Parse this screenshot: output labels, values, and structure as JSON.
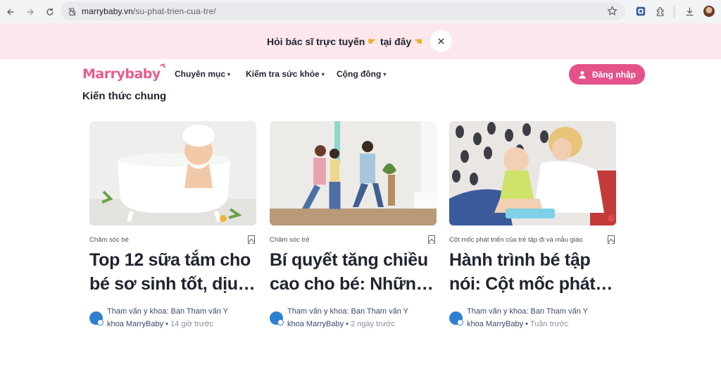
{
  "browser": {
    "url_host": "marrybaby.vn",
    "url_path": "/su-phat-trien-cua-tre/"
  },
  "promo": {
    "text_before": "Hỏi bác sĩ trực tuyến",
    "text_after": "tại đây"
  },
  "header": {
    "logo": "Marrybaby",
    "menu": [
      {
        "label": "Chuyên mục"
      },
      {
        "label": "Kiểm tra sức khỏe"
      },
      {
        "label": "Cộng đồng"
      }
    ],
    "login_label": "Đăng nhập"
  },
  "section": {
    "title": "Kiến thức chung"
  },
  "cards": [
    {
      "category": "Chăm sóc bé",
      "title_line1": "Top 12 sữa tắm cho",
      "title_line2": "bé sơ sinh tốt, dịu…",
      "author_line1": "Tham vấn y khoa: Ban Tham vấn Y",
      "author_line2": "khoa MarryBaby",
      "time": "14 giờ trước"
    },
    {
      "category": "Chăm sóc trẻ",
      "title_line1": "Bí quyết tăng chiều",
      "title_line2": "cao cho bé: Nhữn…",
      "author_line1": "Tham vấn y khoa: Ban Tham vấn Y",
      "author_line2": "khoa MarryBaby",
      "time": "2 ngày trước"
    },
    {
      "category": "Cột mốc phát triển của trẻ tập đi và mẫu giáo",
      "title_line1": "Hành trình bé tập",
      "title_line2": "nói: Cột mốc phát…",
      "author_line1": "Tham vấn y khoa: Ban Tham vấn Y",
      "author_line2": "khoa MarryBaby",
      "time": "Tuần trước"
    }
  ],
  "colors": {
    "brand_pink": "#e5528a",
    "banner_bg": "#fbe7ec",
    "text_dark": "#1f2430"
  }
}
